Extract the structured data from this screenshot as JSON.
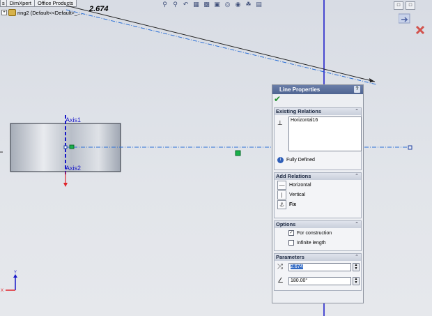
{
  "tabs": [
    "s",
    "DimXpert",
    "Office Products"
  ],
  "tree": {
    "expander": "+",
    "item_label": "ring2  (Default<<Default>_..."
  },
  "hud_icons": [
    "zoom-fit-icon",
    "zoom-area-icon",
    "previous-view-icon",
    "section-view-icon",
    "view-orientation-icon",
    "display-style-icon",
    "hide-show-icon",
    "edit-appearance-icon",
    "apply-scene-icon",
    "view-settings-icon"
  ],
  "canvas": {
    "dimension_value": "2.674",
    "axis1_label": "Axis1",
    "axis2_label": "Axis2",
    "triad_y_label": "Y",
    "triad_x_label": "X"
  },
  "colors": {
    "accent": "#1f1fd0",
    "construction_line": "#2a6fd6",
    "axis": "#1717c8",
    "pm_title": "#5a6f9e"
  },
  "pm": {
    "title": "Line Properties",
    "help": "?",
    "ok_icon": "checkmark-icon",
    "existing_relations": {
      "header": "Existing Relations",
      "items": [
        "Horizontal16"
      ],
      "status": "Fully Defined"
    },
    "add_relations": {
      "header": "Add Relations",
      "items": [
        "Horizontal",
        "Vertical",
        "Fix"
      ]
    },
    "options": {
      "header": "Options",
      "for_construction_label": "For construction",
      "for_construction_checked": true,
      "infinite_length_label": "Infinite length",
      "infinite_length_checked": false
    },
    "parameters": {
      "header": "Parameters",
      "length_value": "2.674",
      "angle_value": "180.00°"
    }
  }
}
